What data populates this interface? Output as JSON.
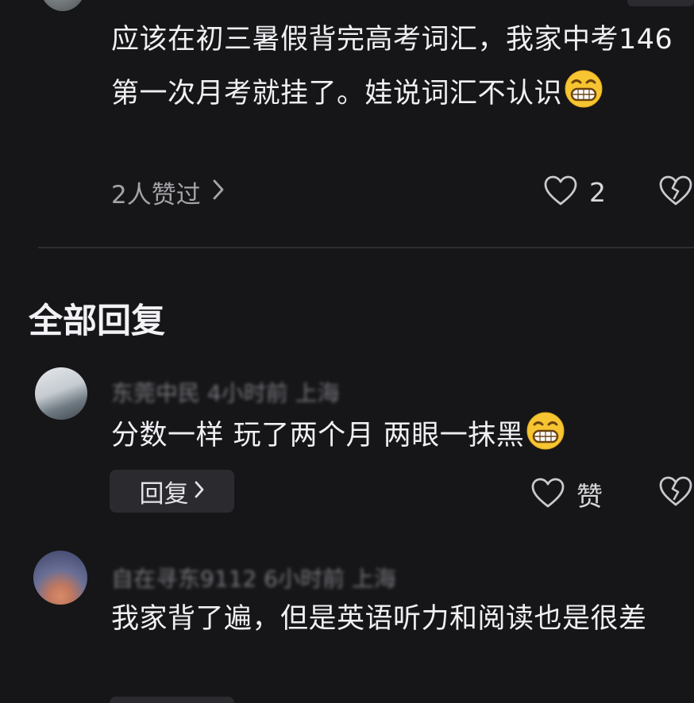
{
  "thread": {
    "main_comment": {
      "text": "应该在初三暑假背完高考词汇，我家中考146第一次月考就挂了。娃说词汇不认识",
      "emoji": "grinning-emoji",
      "likes_summary": "2人赞过",
      "like_count": "2"
    },
    "section_title": "全部回复",
    "replies": [
      {
        "meta_blurred": "东莞中民 4小时前 上海",
        "text": "分数一样 玩了两个月 两眼一抹黑",
        "emoji": "grinning-emoji",
        "reply_label": "回复",
        "like_label": "赞"
      },
      {
        "meta_blurred": "自在寻东9112 6小时前 上海",
        "text": "我家背了遍，但是英语听力和阅读也是很差"
      }
    ]
  },
  "colors": {
    "background": "#161618",
    "text_primary": "#f0eff3",
    "text_muted": "#a4a3a9",
    "button_bg": "#2b2b2f",
    "emoji_yellow": "#f7c531"
  }
}
